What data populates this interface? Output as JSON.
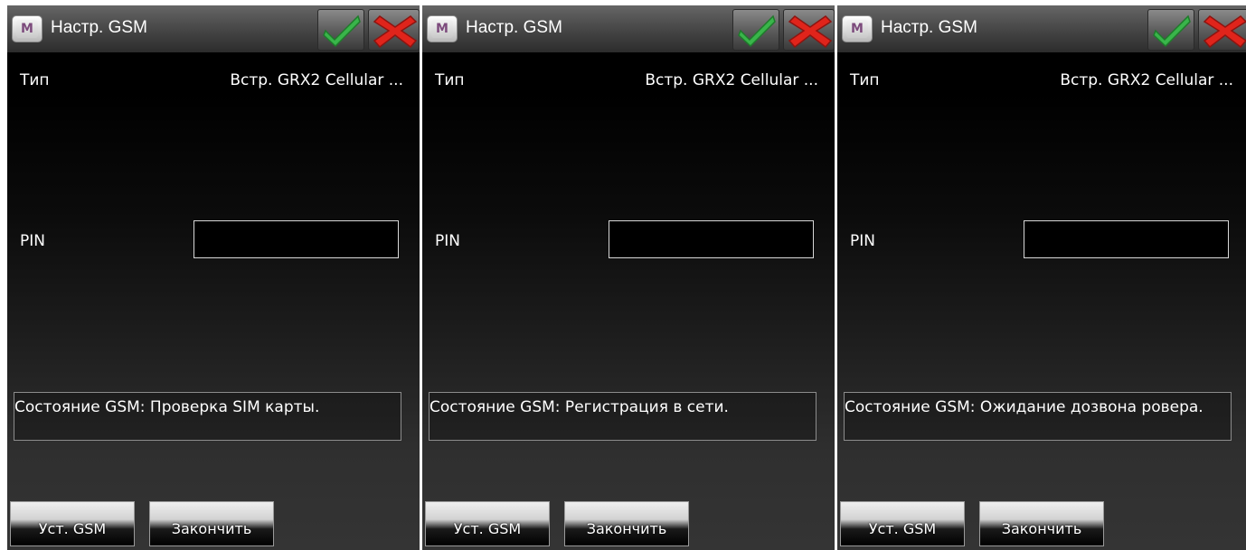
{
  "screens": [
    {
      "title": "Настр. GSM",
      "menu_icon_letter": "M",
      "type_label": "Тип",
      "type_value": "Встр. GRX2 Cellular ...",
      "pin_label": "PIN",
      "pin_value": "",
      "status": "Состояние GSM: Проверка SIM карты.",
      "set_gsm_label": "Уст. GSM",
      "finish_label": "Закончить"
    },
    {
      "title": "Настр. GSM",
      "menu_icon_letter": "M",
      "type_label": "Тип",
      "type_value": "Встр. GRX2 Cellular ...",
      "pin_label": "PIN",
      "pin_value": "",
      "status": "Состояние GSM: Регистрация в сети.",
      "set_gsm_label": "Уст. GSM",
      "finish_label": "Закончить"
    },
    {
      "title": "Настр. GSM",
      "menu_icon_letter": "M",
      "type_label": "Тип",
      "type_value": "Встр. GRX2 Cellular ...",
      "pin_label": "PIN",
      "pin_value": "",
      "status": "Состояние GSM: Ожидание дозвона ровера.",
      "set_gsm_label": "Уст. GSM",
      "finish_label": "Закончить"
    }
  ],
  "colors": {
    "accept_green": "#39b54a",
    "cancel_red": "#e0241b",
    "background": "#000000",
    "text": "#ffffff"
  },
  "icons": {
    "menu": "menu-icon",
    "accept": "checkmark-icon",
    "cancel": "close-icon"
  }
}
